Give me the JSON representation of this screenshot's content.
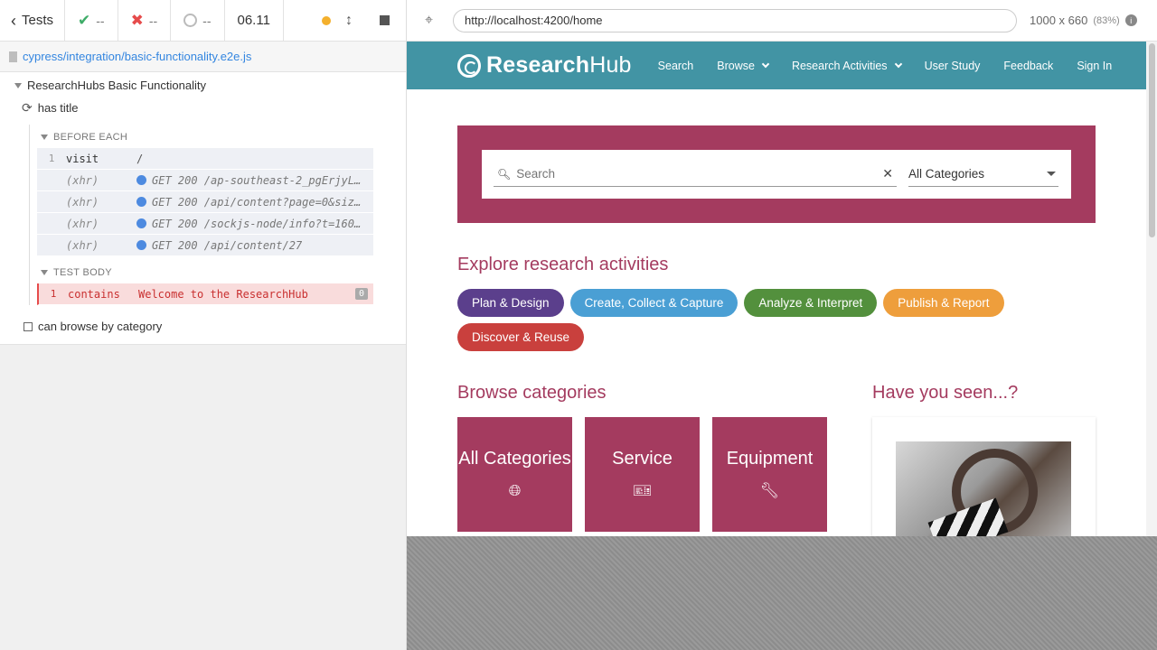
{
  "reporter": {
    "back_label": "Tests",
    "passed": "--",
    "failed": "--",
    "pending": "--",
    "duration": "06.11",
    "spec_path": "cypress/integration/basic-functionality.e2e.js",
    "suite_title": "ResearchHubs Basic Functionality",
    "test1_title": "has title",
    "before_each_label": "BEFORE EACH",
    "test_body_label": "TEST BODY",
    "commands": [
      {
        "num": "1",
        "name": "visit",
        "msg": "/"
      },
      {
        "xhr": "(xhr)",
        "msg": "GET 200 /ap-southeast-2_pgErjyL4…"
      },
      {
        "xhr": "(xhr)",
        "msg": "GET 200 /api/content?page=0&size…"
      },
      {
        "xhr": "(xhr)",
        "msg": "GET 200 /sockjs-node/info?t=1605…"
      },
      {
        "xhr": "(xhr)",
        "msg": "GET 200 /api/content/27"
      }
    ],
    "body_command": {
      "num": "1",
      "name": "contains",
      "msg": "Welcome to the ResearchHub",
      "badge": "0"
    },
    "test2_title": "can browse by category"
  },
  "aut": {
    "url": "http://localhost:4200/home",
    "viewport": "1000 x 660",
    "scale": "(83%)"
  },
  "site": {
    "logo_bold": "Research",
    "logo_light": "Hub",
    "nav": {
      "search": "Search",
      "browse": "Browse",
      "research_activities": "Research Activities",
      "user_study": "User Study",
      "feedback": "Feedback",
      "sign_in": "Sign In"
    },
    "search_placeholder": "Search",
    "category_selected": "All Categories",
    "explore_title": "Explore research activities",
    "activities": [
      {
        "label": "Plan & Design",
        "color": "#5b3f8c"
      },
      {
        "label": "Create, Collect & Capture",
        "color": "#4a9fd4"
      },
      {
        "label": "Analyze & Interpret",
        "color": "#53903d"
      },
      {
        "label": "Publish & Report",
        "color": "#ee9e3c"
      },
      {
        "label": "Discover & Reuse",
        "color": "#c9403d"
      }
    ],
    "browse_title": "Browse categories",
    "categories": [
      {
        "label": "All Categories",
        "icon": "globe-icon"
      },
      {
        "label": "Service",
        "icon": "ticket-icon"
      },
      {
        "label": "Equipment",
        "icon": "wrench-icon"
      }
    ],
    "seen_title": "Have you seen...?"
  },
  "colors": {
    "navbar": "#4294a4",
    "brand": "#a43b5f",
    "pass": "#3eac68",
    "fail": "#e64b4b",
    "xhr": "#4d8ae0"
  }
}
